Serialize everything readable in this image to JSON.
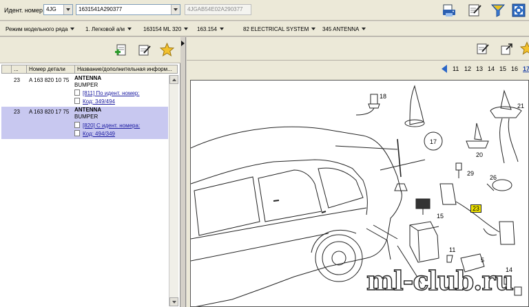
{
  "top": {
    "ident_label": "Идент. номер",
    "prefix_value": "4JG",
    "vin_value": "1631541A290377",
    "full_id_placeholder": "4JGAB54E02A290377"
  },
  "breadcrumbs": [
    "Режим модельного ряда",
    "1. Легковой а/м",
    "163154 ML 320",
    "163.154",
    "82 ELECTRICAL SYSTEM",
    "345 ANTENNA"
  ],
  "grid": {
    "headers": [
      "...",
      "Номер детали",
      "Название/дополнительная информ..."
    ],
    "rows": [
      {
        "pos": "23",
        "part_number": "A 163 820 10 75",
        "name": "ANTENNA",
        "sub": "BUMPER",
        "links": [
          "[811] По идент. номер:",
          "Код: 349/494"
        ]
      },
      {
        "pos": "23",
        "part_number": "A 163 820 17 75",
        "name": "ANTENNA",
        "sub": "BUMPER",
        "links": [
          "[820] С идент. номера:",
          "Код: 494/349"
        ]
      }
    ]
  },
  "pager": {
    "pages": [
      "11",
      "12",
      "13",
      "14",
      "15",
      "16"
    ],
    "current": "17"
  },
  "diagram": {
    "callouts": [
      "18",
      "21",
      "17",
      "20",
      "29",
      "26",
      "23",
      "15",
      "11",
      "5",
      "14"
    ]
  },
  "watermark": "ml-club.ru",
  "colors": {
    "selected_row": "#c8c8f0",
    "link": "#1a1aa0",
    "highlight_callout": "#f2e600",
    "pager_current": "#1a3ea8"
  },
  "icons": [
    "print-icon",
    "edit-icon",
    "filter-icon",
    "fullscreen-icon",
    "add-document-icon",
    "star-icon",
    "zoom-icon",
    "prev-page-icon"
  ]
}
